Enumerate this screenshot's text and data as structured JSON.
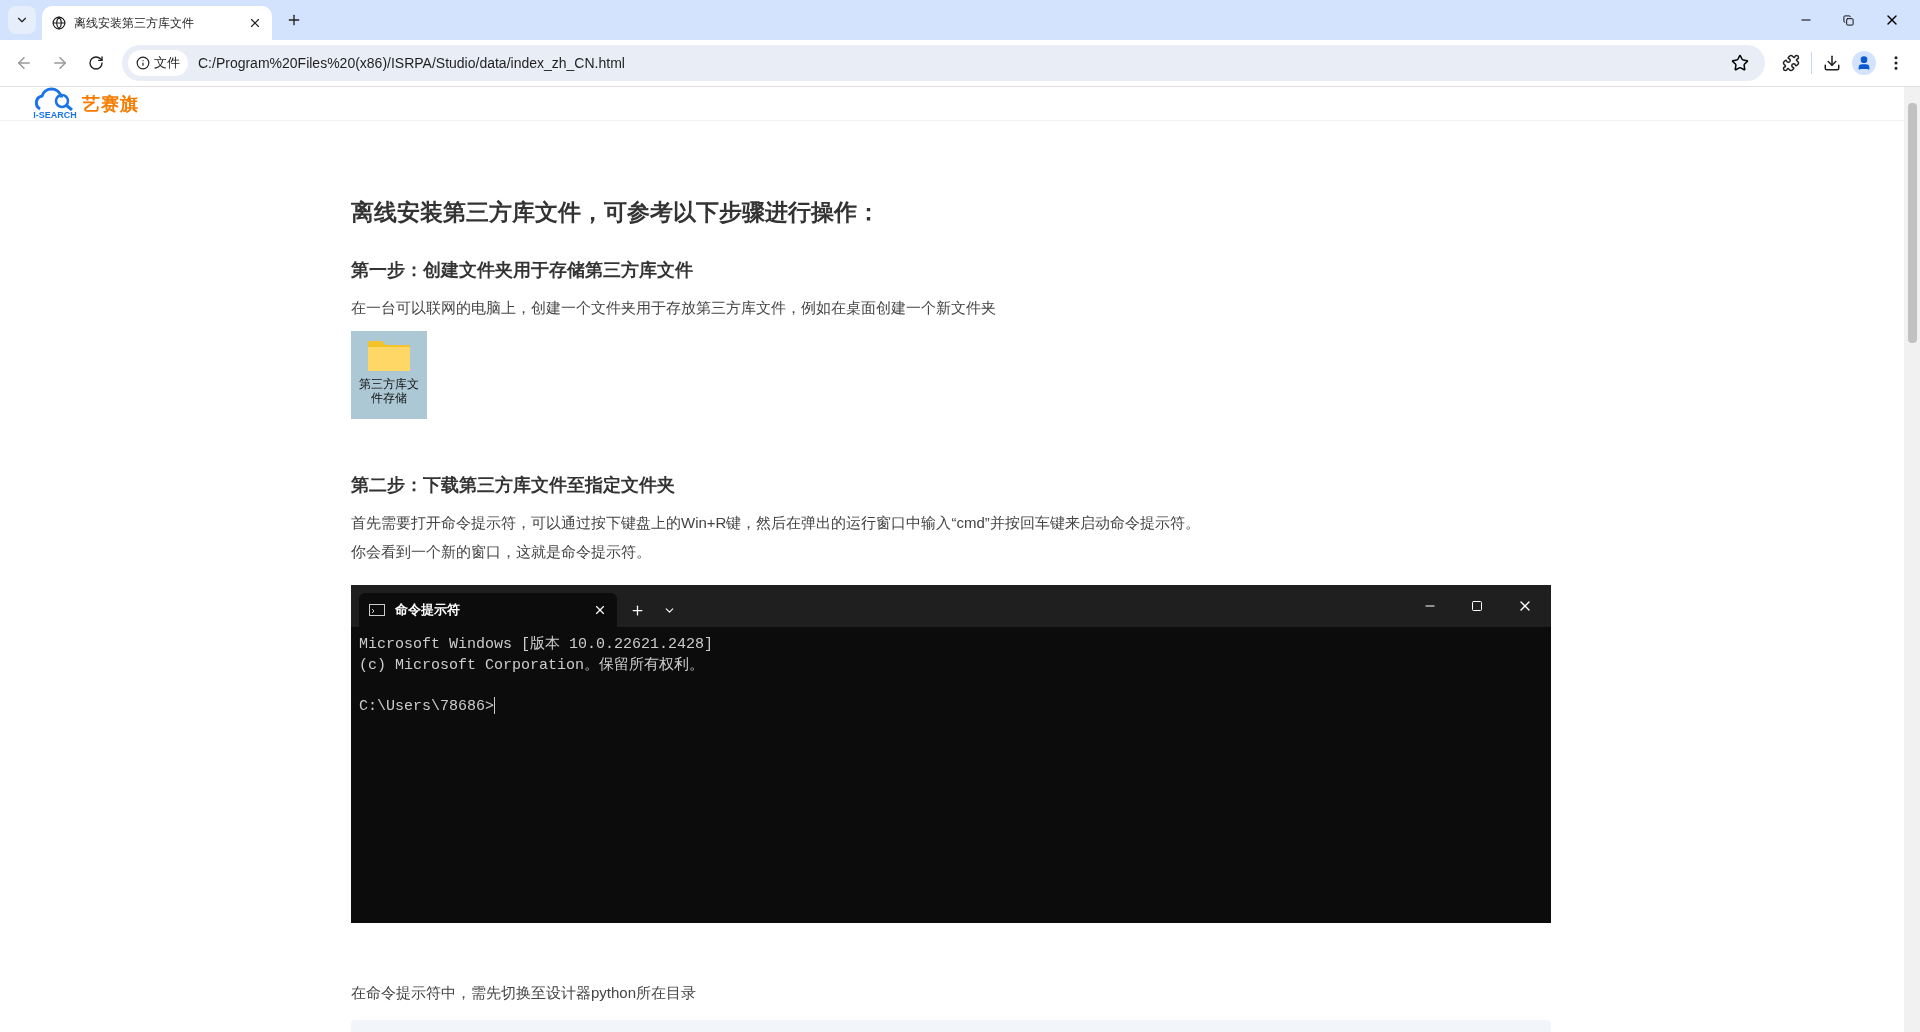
{
  "browser": {
    "tabs": [
      {
        "title": "离线安装第三方库文件",
        "selected": true
      }
    ],
    "address": {
      "badge": "文件",
      "url": "C:/Program%20Files%20(x86)/ISRPA/Studio/data/index_zh_CN.html"
    }
  },
  "site": {
    "logo_text": "艺赛旗",
    "logo_sub": "I-SEARCH"
  },
  "article": {
    "title": "离线安装第三方库文件，可参考以下步骤进行操作：",
    "blocks": [
      {
        "kind": "heading",
        "text": "第一步：创建文件夹用于存储第三方库文件"
      },
      {
        "kind": "paragraph",
        "text": "在一台可以联网的电脑上，创建一个文件夹用于存放第三方库文件，例如在桌面创建一个新文件夹"
      },
      {
        "kind": "folder",
        "label": "第三方库文件存储"
      },
      {
        "kind": "heading",
        "text": "第二步：下载第三方库文件至指定文件夹"
      },
      {
        "kind": "paragraph",
        "text": "首先需要打开命令提示符，可以通过按下键盘上的Win+R键，然后在弹出的运行窗口中输入“cmd”并按回车键来启动命令提示符。"
      },
      {
        "kind": "paragraph",
        "text": "你会看到一个新的窗口，这就是命令提示符。"
      },
      {
        "kind": "terminal",
        "tab": "命令提示符",
        "lines": [
          "Microsoft Windows [版本 10.0.22621.2428]",
          "(c) Microsoft Corporation。保留所有权利。"
        ],
        "prompt": "C:\\Users\\78686>"
      },
      {
        "kind": "paragraph",
        "text": "在命令提示符中，需先切换至设计器python所在目录"
      },
      {
        "kind": "codeblock"
      }
    ]
  }
}
